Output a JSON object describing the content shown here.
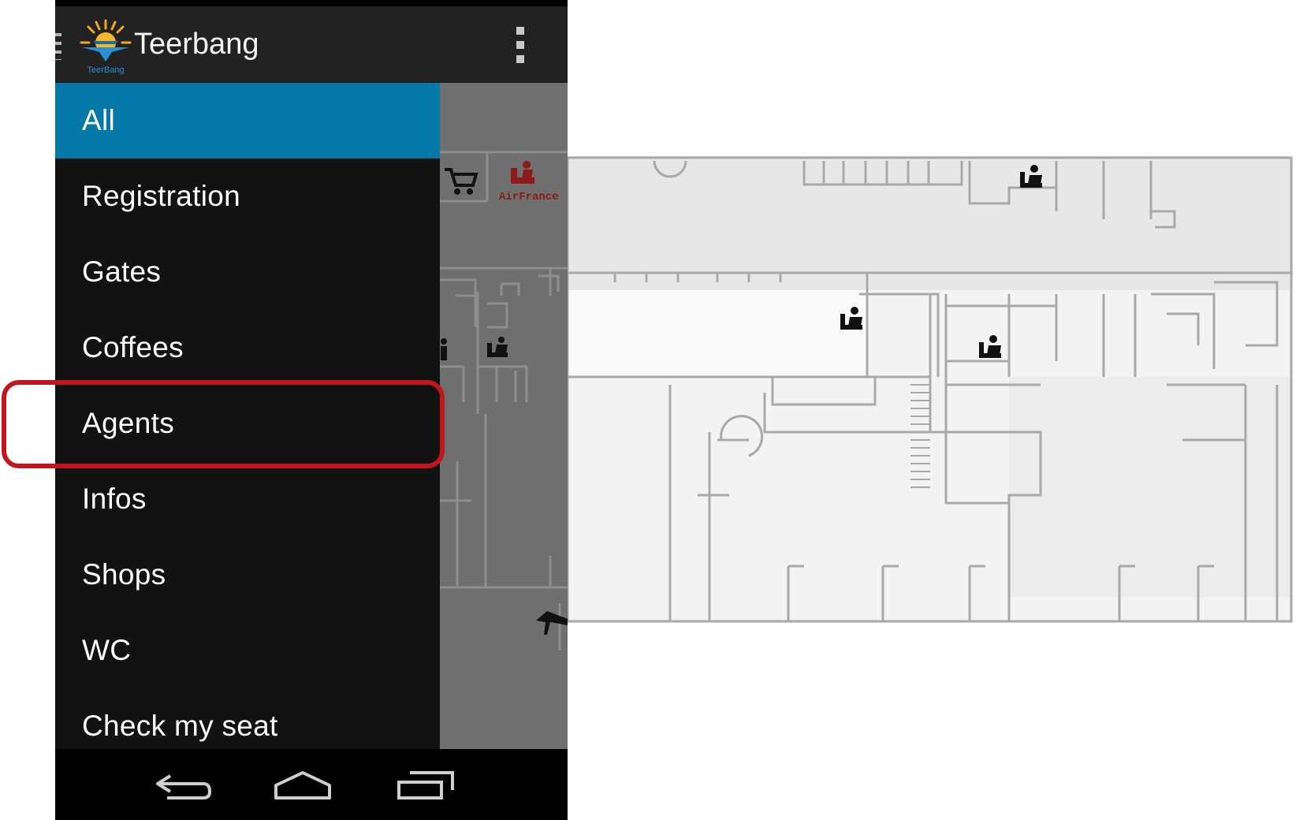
{
  "app": {
    "title": "Teerbang",
    "logo_text": "TeerBang",
    "logo_icon": "sun-airplane-logo-icon"
  },
  "menu": {
    "selected": "All",
    "items": [
      {
        "label": "All"
      },
      {
        "label": "Registration"
      },
      {
        "label": "Gates"
      },
      {
        "label": "Coffees"
      },
      {
        "label": "Agents"
      },
      {
        "label": "Infos"
      },
      {
        "label": "Shops"
      },
      {
        "label": "WC"
      },
      {
        "label": "Check my seat"
      }
    ]
  },
  "map_behind": {
    "poi_label": "AirFrance"
  },
  "annotation": {
    "highlighted_item": "Agents",
    "color": "#c0171d"
  },
  "navigation_bar": {
    "icons": [
      "back-icon",
      "home-icon",
      "recent-apps-icon"
    ]
  },
  "colors": {
    "selected_item_background": "#0479a8",
    "drawer_background": "#121212",
    "action_bar_background": "#222222",
    "airfrance_brand": "#8b1a1a"
  }
}
